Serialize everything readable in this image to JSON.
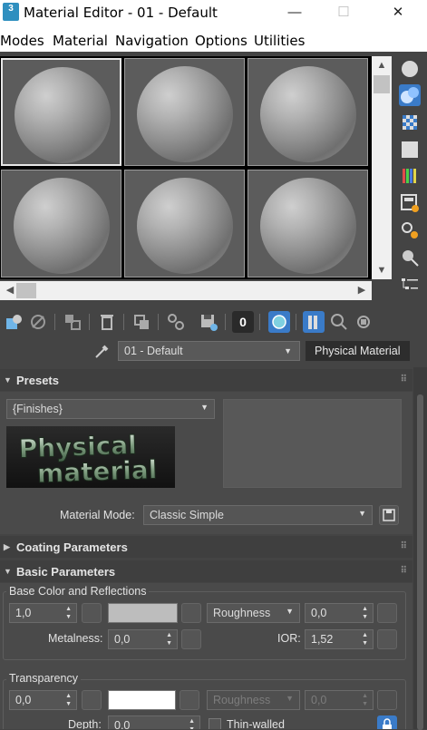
{
  "window": {
    "app_icon_text": "3",
    "title": "Material Editor - 01 - Default",
    "minimize": "—",
    "maximize": "☐",
    "close": "✕"
  },
  "menus": [
    "Modes",
    "Material",
    "Navigation",
    "Options",
    "Utilities"
  ],
  "material": {
    "name": "01 - Default",
    "type": "Physical Material"
  },
  "toolbar": {
    "material_id": "0"
  },
  "presets": {
    "title": "Presets",
    "finishes": "{Finishes}",
    "logo_text": "Physical material",
    "mode_label": "Material Mode:",
    "mode_value": "Classic Simple"
  },
  "coating": {
    "title": "Coating Parameters"
  },
  "basic": {
    "title": "Basic Parameters",
    "base_group": "Base Color and Reflections",
    "base_weight": "1,0",
    "roughness_mode": "Roughness",
    "roughness": "0,0",
    "metalness_label": "Metalness:",
    "metalness": "0,0",
    "ior_label": "IOR:",
    "ior": "1,52",
    "base_color": "#bdbdbd",
    "transparency_group": "Transparency",
    "transparency_weight": "0,0",
    "transparency_color": "#ffffff",
    "transparency_roughness_mode": "Roughness",
    "transparency_roughness": "0,0",
    "depth_label": "Depth:",
    "depth": "0,0",
    "thin_walled_label": "Thin-walled"
  }
}
